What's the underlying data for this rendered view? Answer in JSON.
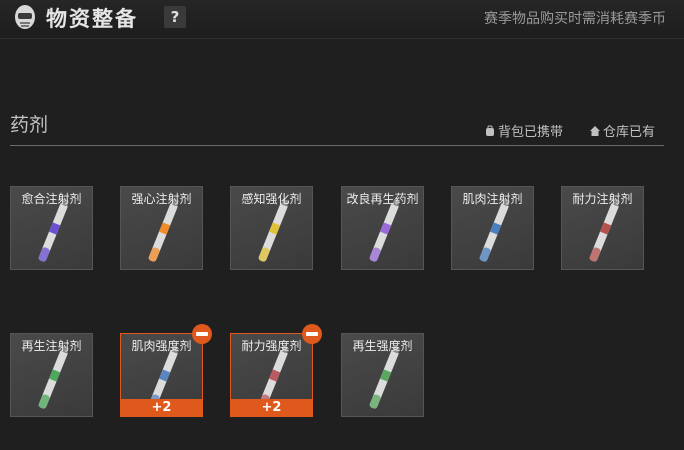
{
  "header": {
    "title": "物资整备",
    "help_label": "?",
    "notice": "赛季物品购买时需消耗赛季币"
  },
  "section": {
    "title": "药剂",
    "legend_bag": "背包已携带",
    "legend_warehouse": "仓库已有"
  },
  "colors": {
    "accent": "#e0591c"
  },
  "items": [
    {
      "name": "愈合注射剂",
      "color": "#6a4fd0",
      "selected": false
    },
    {
      "name": "强心注射剂",
      "color": "#f08a2a",
      "selected": false
    },
    {
      "name": "感知强化剂",
      "color": "#e0c23a",
      "selected": false
    },
    {
      "name": "改良再生药剂",
      "color": "#9a6ad8",
      "selected": false
    },
    {
      "name": "肌肉注射剂",
      "color": "#4a7fbf",
      "selected": false
    },
    {
      "name": "耐力注射剂",
      "color": "#b4524e",
      "selected": false
    },
    {
      "name": "再生注射剂",
      "color": "#4fa85c",
      "selected": false
    },
    {
      "name": "肌肉强度剂",
      "color": "#5a86c0",
      "selected": true,
      "count": "+2"
    },
    {
      "name": "耐力强度剂",
      "color": "#b85a60",
      "selected": true,
      "count": "+2"
    },
    {
      "name": "再生强度剂",
      "color": "#5aa860",
      "selected": false
    }
  ]
}
